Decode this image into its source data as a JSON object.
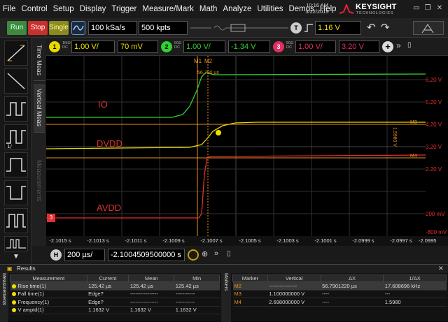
{
  "menu": [
    "File",
    "Control",
    "Setup",
    "Display",
    "Trigger",
    "Measure/Mark",
    "Math",
    "Analyze",
    "Utilities",
    "Demos",
    "Help"
  ],
  "datetime": {
    "time": "10:16 AM",
    "date": "3/22/2019"
  },
  "brand": {
    "name": "KEYSIGHT",
    "sub": "TECHNOLOGIES"
  },
  "toolbar": {
    "run": "Run",
    "stop": "Stop",
    "single": "Single",
    "sample_rate": "100 kSa/s",
    "memory_depth": "500 kpts",
    "trigger_badge": "T",
    "trigger_level": "1.16 V"
  },
  "channels": [
    {
      "id": "1",
      "coupling": "1MΩ",
      "dc": "DC",
      "scale": "1.00 V/",
      "offset": "70 mV",
      "color": "#e8d800"
    },
    {
      "id": "2",
      "coupling": "50Ω",
      "dc": "DC",
      "scale": "1.00 V/",
      "offset": "-1.34 V",
      "color": "#30d030"
    },
    {
      "id": "3",
      "coupling": "50Ω",
      "dc": "DC",
      "scale": "1.00 V/",
      "offset": "3.20 V",
      "color": "#e03060"
    }
  ],
  "side_tabs": [
    "Time Meas",
    "Vertical Meas",
    "Measurements"
  ],
  "markers": {
    "m1": "M1",
    "m2": "M2",
    "delta": "56.790 µs",
    "m3": "M3",
    "m4": "M4",
    "m4_value": "1.5980 V"
  },
  "signals": {
    "io": "IO",
    "dvdd": "DVDD",
    "avdd": "AVDD"
  },
  "y_ticks": [
    "6.20 V",
    "5.20 V",
    "4.20 V",
    "3.20 V",
    "2.20 V",
    "200 mV",
    "-800 mV"
  ],
  "x_ticks": [
    "-2.1015 s",
    "-2.1013 s",
    "-2.1011 s",
    "-2.1009 s",
    "-2.1007 s",
    "-2.1005 s",
    "-2.1003 s",
    "-2.1001 s",
    "-2.0999 s",
    "-2.0997 s",
    "-2.0995 s"
  ],
  "horizontal": {
    "badge": "H",
    "scale": "200 µs/",
    "position": "-2.1004509500000 s"
  },
  "results": {
    "title": "Results",
    "side_tab": "Measurements",
    "markers_tab": "Markers",
    "meas_headers": [
      "Measurement",
      "Current",
      "Mean",
      "Min"
    ],
    "meas_rows": [
      [
        "Rise time(1)",
        "125.42 µs",
        "125.42 µs",
        "125.42 µs"
      ],
      [
        "Fall time(1)",
        "Edge?",
        "----------------",
        "-----------"
      ],
      [
        "Frequency(1)",
        "Edge?",
        "----------------",
        "-----------"
      ],
      [
        "V amptd(1)",
        "1.1632 V",
        "1.1632 V",
        "1.1632 V"
      ]
    ],
    "marker_headers": [
      "Marker",
      "Vertical",
      "ΔX",
      "1/ΔX"
    ],
    "marker_rows": [
      [
        "M2",
        "----------------",
        "56.7901220 µs",
        "17.608696 kHz"
      ],
      [
        "M3",
        "1.100000000 V",
        "----",
        "---"
      ],
      [
        "M4",
        "2.698000000 V",
        "----",
        "1.5980"
      ]
    ]
  }
}
